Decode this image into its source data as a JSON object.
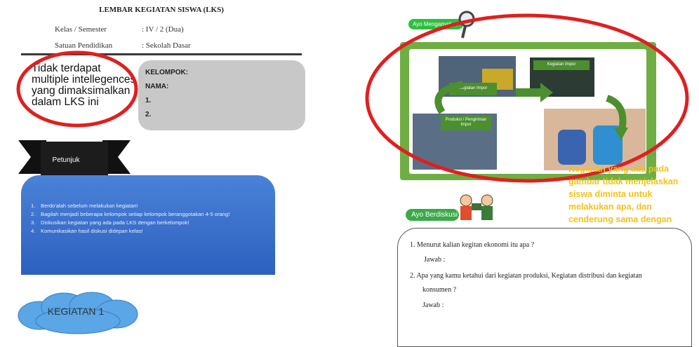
{
  "left_page": {
    "title": "LEMBAR KEGIATAN SISWA (LKS)",
    "meta": [
      {
        "label": "Kelas / Semester",
        "value": ": IV / 2 (Dua)"
      },
      {
        "label": "Satuan Pendidikan",
        "value": ": Sekolah Dasar"
      }
    ],
    "annotation": "Tidak terdapat multiple intellegences yang dimaksimalkan dalam LKS ini",
    "group_box": {
      "kelompok_label": "KELOMPOK:",
      "nama_label": "NAMA:",
      "lines": [
        "1.",
        "2."
      ]
    },
    "petunjuk_label": "Petunjuk",
    "instructions": [
      {
        "num": "1.",
        "text": "Berdo'alah sebelum melakukan kegiatan!"
      },
      {
        "num": "2.",
        "text": "Bagilah menjadi beberapa kelompok setiap kelompok beranggotakan 4-5 orang!"
      },
      {
        "num": "3.",
        "text": "Diskusikan kegiatan yang ada pada LKS dengan berkelompok!"
      },
      {
        "num": "4.",
        "text": "Komunikasikan hasil diskusi didepan kelas!"
      }
    ],
    "kegiatan_label": "KEGIATAN 1"
  },
  "right_page": {
    "ayo_tag": "Ayo Mengamati",
    "figure_labels": {
      "production": "Kegiatan Impor",
      "distribution": "Kegiatan Impor",
      "consumer": "Produksi / Pengiriman Impor"
    },
    "annotation": "Kegiatan yang ada pada gambar tidak menjelaskan siswa diminta untuk melakukan apa, dan cenderung sama dengan",
    "diskusi_tag": "Ayo Berdiskusi",
    "questions": [
      {
        "num": "1.",
        "text": "Menurut kalian kegitan ekonomi itu apa ?",
        "answer": "Jawab :"
      },
      {
        "num": "2.",
        "text": "Apa yang kamu ketahui dari kegiatan produksi, Kegiatan distribusi dan kegiatan",
        "cont": "konsumen ?",
        "answer": "Jawab :"
      }
    ],
    "colors": {
      "annotation": "#f2c319",
      "frame_green": "#6fae43",
      "tag_green": "#2fbf3f",
      "circle_red": "#e01f1f"
    }
  }
}
